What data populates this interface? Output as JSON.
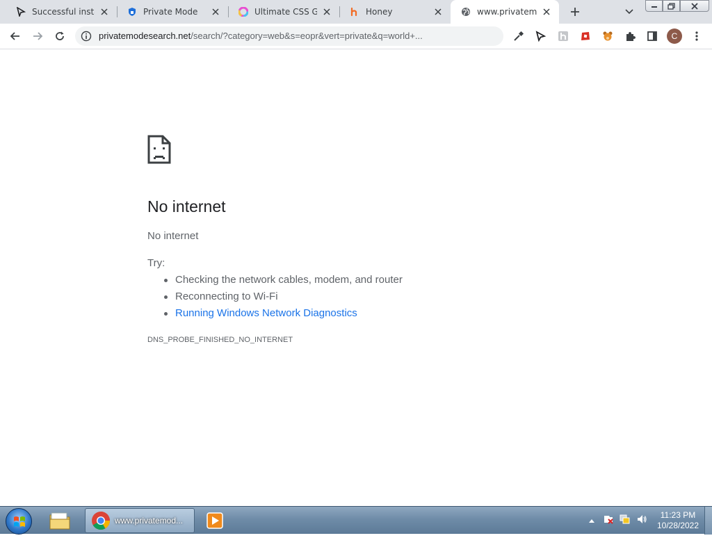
{
  "tabs": [
    {
      "title": "Successful installa",
      "icon": "cursor-arrow-icon"
    },
    {
      "title": "Private Mode",
      "icon": "shield-lock-icon"
    },
    {
      "title": "Ultimate CSS Grad",
      "icon": "color-wheel-icon"
    },
    {
      "title": "Honey",
      "icon": "honey-h-icon"
    },
    {
      "title": "www.privatemode",
      "icon": "globe-icon"
    }
  ],
  "omnibox": {
    "url_host": "privatemodesearch.net",
    "url_path": "/search/?category=web&s=eopr&vert=private&q=world+..."
  },
  "profile": {
    "initial": "C"
  },
  "error_page": {
    "title": "No internet",
    "subtitle": "No internet",
    "try_label": "Try:",
    "suggestions": [
      "Checking the network cables, modem, and router",
      "Reconnecting to Wi-Fi",
      "Running Windows Network Diagnostics"
    ],
    "error_code": "DNS_PROBE_FINISHED_NO_INTERNET"
  },
  "taskbar": {
    "chrome_label": "www.privatemod...",
    "time": "11:23 PM",
    "date": "10/28/2022"
  },
  "colors": {
    "link": "#1a73e8",
    "tabstrip": "#dee1e6",
    "text_secondary": "#5f6368"
  }
}
